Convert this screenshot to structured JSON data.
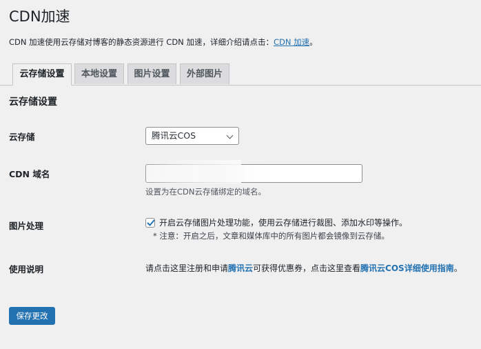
{
  "page": {
    "title": "CDN加速",
    "intro_text": "CDN 加速使用云存储对博客的静态资源进行 CDN 加速，详细介绍请点击：",
    "intro_link": "CDN 加速",
    "intro_suffix": "。"
  },
  "tabs": [
    {
      "label": "云存储设置",
      "active": true
    },
    {
      "label": "本地设置",
      "active": false
    },
    {
      "label": "图片设置",
      "active": false
    },
    {
      "label": "外部图片",
      "active": false
    }
  ],
  "section": {
    "title": "云存储设置"
  },
  "fields": {
    "storage": {
      "label": "云存储",
      "selected": "腾讯云COS"
    },
    "cdn_domain": {
      "label": "CDN 域名",
      "value": "",
      "hint": "设置为在CDN云存储绑定的域名。"
    },
    "image_processing": {
      "label": "图片处理",
      "checked": true,
      "checkbox_label": "开启云存储图片处理功能，使用云存储进行裁图、添加水印等操作。",
      "note": "* 注意：开启之后，文章和媒体库中的所有图片都会镜像到云存储。"
    },
    "usage": {
      "label": "使用说明",
      "text_1": "请点击这里注册和申请",
      "link_1": "腾讯云",
      "text_2": "可获得优惠券，点击这里查看",
      "link_2": "腾讯云COS详细使用指南",
      "text_3": "。"
    }
  },
  "actions": {
    "save_label": "保存更改"
  },
  "colors": {
    "accent": "#2271b1",
    "background": "#f0f0f1"
  }
}
